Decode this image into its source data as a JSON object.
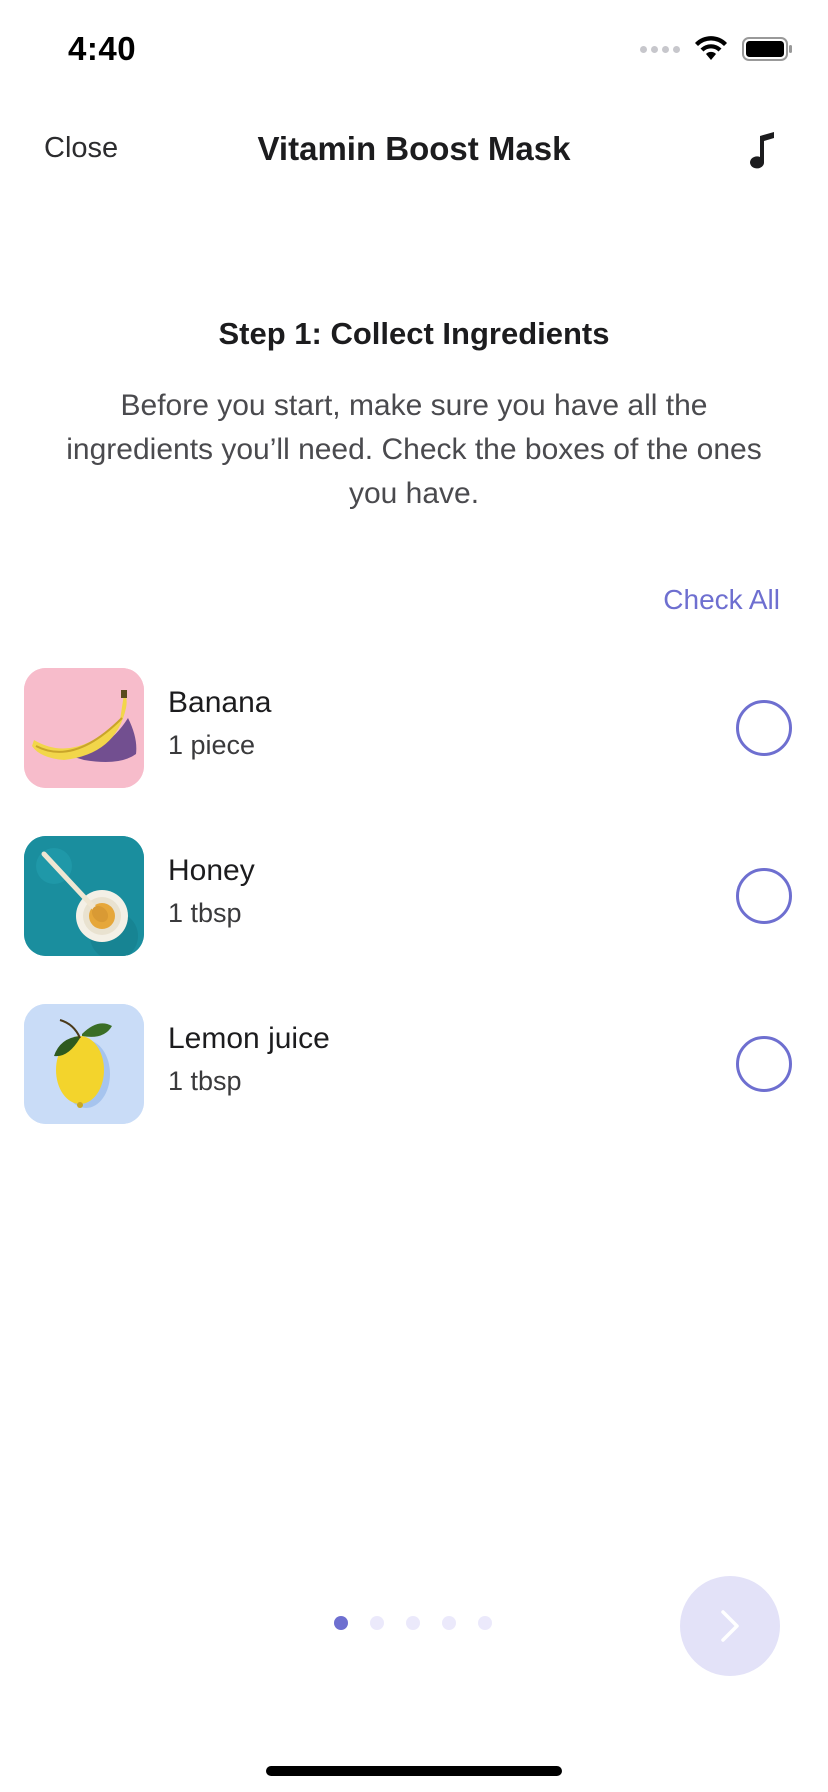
{
  "status_bar": {
    "time": "4:40"
  },
  "nav": {
    "close_label": "Close",
    "title": "Vitamin Boost Mask",
    "music_icon": "music-note-icon"
  },
  "step": {
    "title": "Step 1: Collect Ingredients",
    "description": "Before you start, make sure you have all the ingredients you’ll need. Check the boxes of the ones you have."
  },
  "check_all_label": "Check All",
  "ingredients": [
    {
      "name": "Banana",
      "quantity": "1 piece",
      "thumb_bg": "#f7bccb",
      "checked": false
    },
    {
      "name": "Honey",
      "quantity": "1 tbsp",
      "thumb_bg": "#1a8e9e",
      "checked": false
    },
    {
      "name": "Lemon juice",
      "quantity": "1 tbsp",
      "thumb_bg": "#c9dcf7",
      "checked": false
    }
  ],
  "pager": {
    "current_page": 1,
    "total_pages": 5
  },
  "colors": {
    "accent": "#6e6fd0",
    "next_button_bg": "#e3e2f8"
  }
}
